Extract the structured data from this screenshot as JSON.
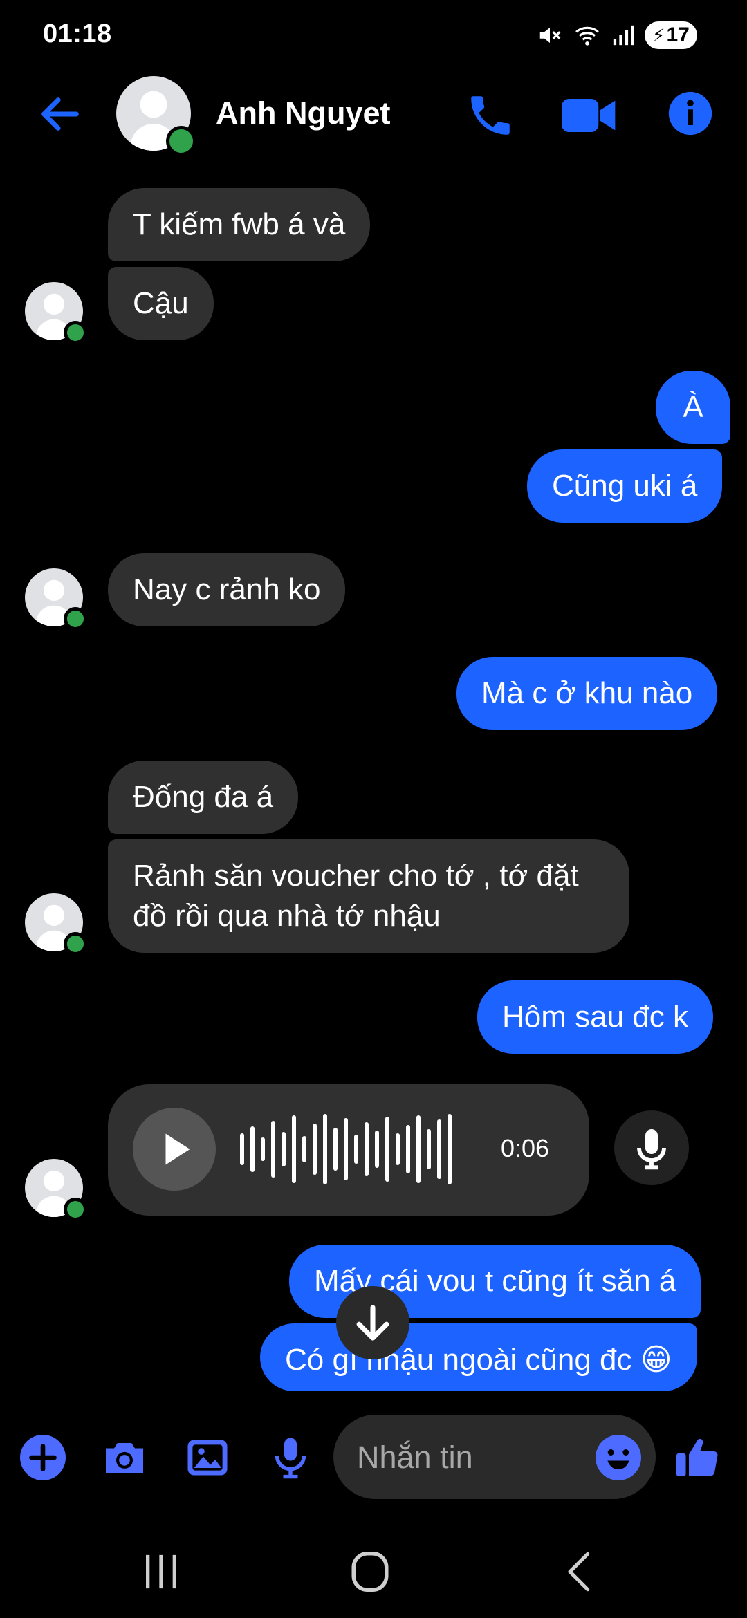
{
  "status_bar": {
    "time": "01:18",
    "battery": "17"
  },
  "header": {
    "contact_name": "Anh Nguyet"
  },
  "messages": [
    {
      "text": "T kiếm fwb á và"
    },
    {
      "text": "Cậu"
    },
    {
      "text": "À"
    },
    {
      "text": "Cũng uki á"
    },
    {
      "text": "Nay c rảnh ko"
    },
    {
      "text": "Mà c ở khu nào"
    },
    {
      "text": "Đống đa á"
    },
    {
      "text": "Rảnh săn voucher cho tớ , tớ đặt đồ rồi qua nhà tớ nhậu"
    },
    {
      "text": "Hôm sau đc k"
    },
    {
      "text": "Mấy cái vou t cũng ít săn á"
    },
    {
      "text": "Có gì nhậu ngoài cũng đc 😁"
    }
  ],
  "voice_message": {
    "duration": "0:06"
  },
  "composer": {
    "placeholder": "Nhắn tin"
  },
  "colors": {
    "accent": "#1c63ff",
    "incoming_bubble": "#303030",
    "online": "#31a24c"
  },
  "icons": [
    "back-arrow-icon",
    "phone-icon",
    "video-camera-icon",
    "info-icon",
    "plus-icon",
    "camera-icon",
    "image-icon",
    "microphone-icon",
    "emoji-icon",
    "thumbs-up-icon",
    "arrow-down-icon",
    "play-icon"
  ]
}
